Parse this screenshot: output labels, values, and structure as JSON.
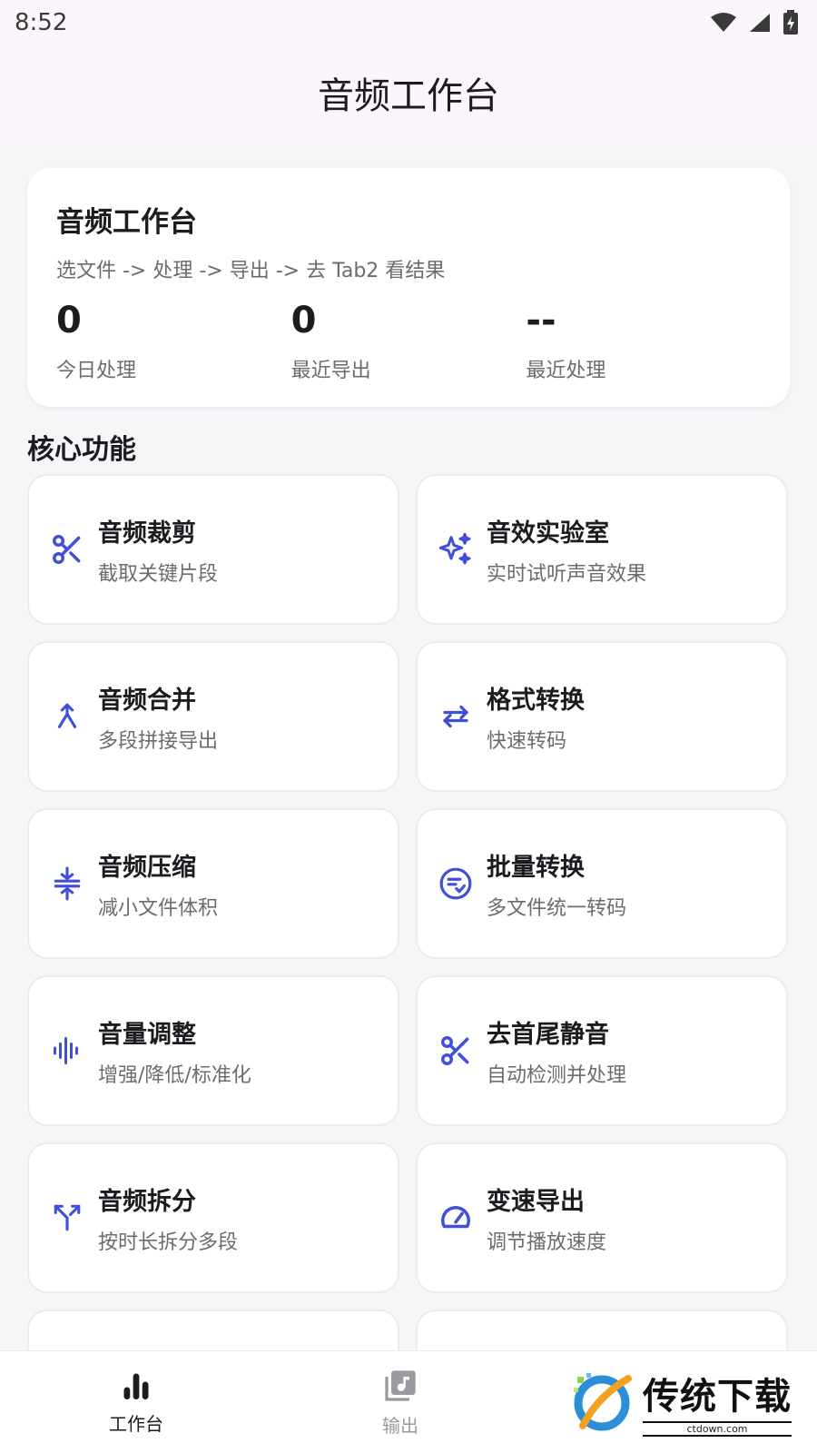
{
  "status_bar": {
    "time": "8:52"
  },
  "app_bar": {
    "title": "音频工作台"
  },
  "summary": {
    "title": "音频工作台",
    "subtitle": "选文件 -> 处理 -> 导出 -> 去 Tab2 看结果",
    "stats": [
      {
        "value": "0",
        "label": "今日处理"
      },
      {
        "value": "0",
        "label": "最近导出"
      },
      {
        "value": "--",
        "label": "最近处理"
      }
    ]
  },
  "section": {
    "title": "核心功能"
  },
  "features": [
    {
      "title": "音频裁剪",
      "desc": "截取关键片段",
      "icon": "scissors-icon"
    },
    {
      "title": "音效实验室",
      "desc": "实时试听声音效果",
      "icon": "sparkles-icon"
    },
    {
      "title": "音频合并",
      "desc": "多段拼接导出",
      "icon": "merge-icon"
    },
    {
      "title": "格式转换",
      "desc": "快速转码",
      "icon": "swap-arrows-icon"
    },
    {
      "title": "音频压缩",
      "desc": "减小文件体积",
      "icon": "compress-icon"
    },
    {
      "title": "批量转换",
      "desc": "多文件统一转码",
      "icon": "batch-check-icon"
    },
    {
      "title": "音量调整",
      "desc": "增强/降低/标准化",
      "icon": "waveform-icon"
    },
    {
      "title": "去首尾静音",
      "desc": "自动检测并处理",
      "icon": "scissors-icon"
    },
    {
      "title": "音频拆分",
      "desc": "按时长拆分多段",
      "icon": "split-icon"
    },
    {
      "title": "变速导出",
      "desc": "调节播放速度",
      "icon": "speedometer-icon"
    }
  ],
  "bottom_nav": {
    "items": [
      {
        "label": "工作台",
        "icon": "bar-chart-icon",
        "active": true
      },
      {
        "label": "输出",
        "icon": "music-library-icon",
        "active": false
      }
    ]
  },
  "watermark": {
    "text": "传统下载",
    "url": "ctdown.com"
  },
  "colors": {
    "accent": "#3f4fd8",
    "background": "#f6f5f8",
    "app_bar": "#fcf5fb"
  }
}
